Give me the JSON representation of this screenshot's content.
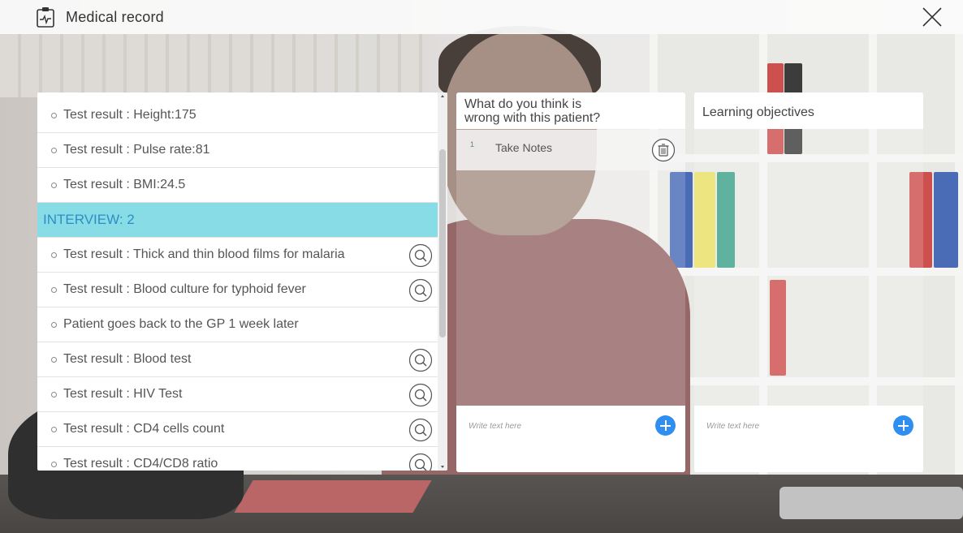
{
  "header": {
    "title": "Medical record",
    "icon": "clipboard-heartbeat-icon",
    "close_icon": "close-icon"
  },
  "list": {
    "items": [
      {
        "type": "item",
        "label": "Test result : Height:175",
        "has_search": false
      },
      {
        "type": "item",
        "label": "Test result : Pulse rate:81",
        "has_search": false
      },
      {
        "type": "item",
        "label": "Test result : BMI:24.5",
        "has_search": false
      },
      {
        "type": "section",
        "label": "INTERVIEW: 2"
      },
      {
        "type": "item",
        "label": "Test result : Thick and thin blood films for malaria",
        "has_search": true
      },
      {
        "type": "item",
        "label": "Test result : Blood culture for typhoid fever",
        "has_search": true
      },
      {
        "type": "item",
        "label": "Patient goes back to the GP 1 week later",
        "has_search": false
      },
      {
        "type": "item",
        "label": "Test result : Blood test",
        "has_search": true
      },
      {
        "type": "item",
        "label": "Test result : HIV Test",
        "has_search": true
      },
      {
        "type": "item",
        "label": "Test result : CD4 cells count",
        "has_search": true
      },
      {
        "type": "item",
        "label": "Test result : CD4/CD8 ratio",
        "has_search": true
      }
    ]
  },
  "diagnosis_panel": {
    "title_line1": "What do you think is",
    "title_line2": "wrong with this patient?",
    "notes": [
      {
        "number": "1",
        "text": "Take Notes"
      }
    ],
    "placeholder": "Write text here"
  },
  "objectives_panel": {
    "title": "Learning objectives",
    "placeholder": "Write text here"
  },
  "colors": {
    "section_bg": "#88dce6",
    "section_text": "#2e8ec4",
    "accent_button": "#2f8ef0"
  }
}
